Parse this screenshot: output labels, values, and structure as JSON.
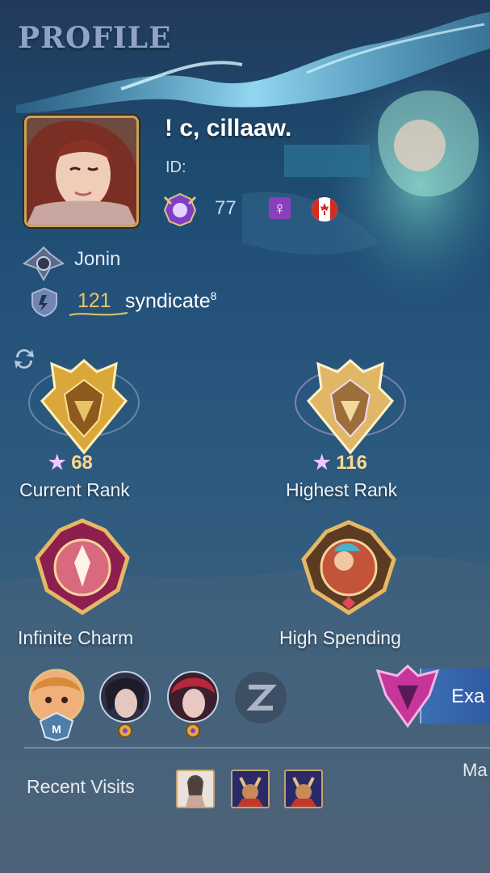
{
  "header": {
    "title": "PROFILE"
  },
  "player": {
    "name": "! c, cillaaw.",
    "id_label": "ID:",
    "level": "77",
    "gender_symbol": "♀",
    "rank_title": "Jonin",
    "squad_count": "121",
    "squad_name": "syndicate",
    "squad_superscript": "8"
  },
  "badges": {
    "current_rank": {
      "stars": "68",
      "label": "Current Rank"
    },
    "highest_rank": {
      "stars": "116",
      "label": "Highest Rank"
    },
    "charm": {
      "label": "Infinite Charm"
    },
    "spending": {
      "label": "High Spending"
    }
  },
  "exa_button": {
    "label": "Exa"
  },
  "side_label": "Ma",
  "recent_visits": {
    "label": "Recent Visits"
  },
  "colors": {
    "gold": "#e9c46a",
    "title": "#8fa3c9",
    "button": "#3d6fb4"
  }
}
